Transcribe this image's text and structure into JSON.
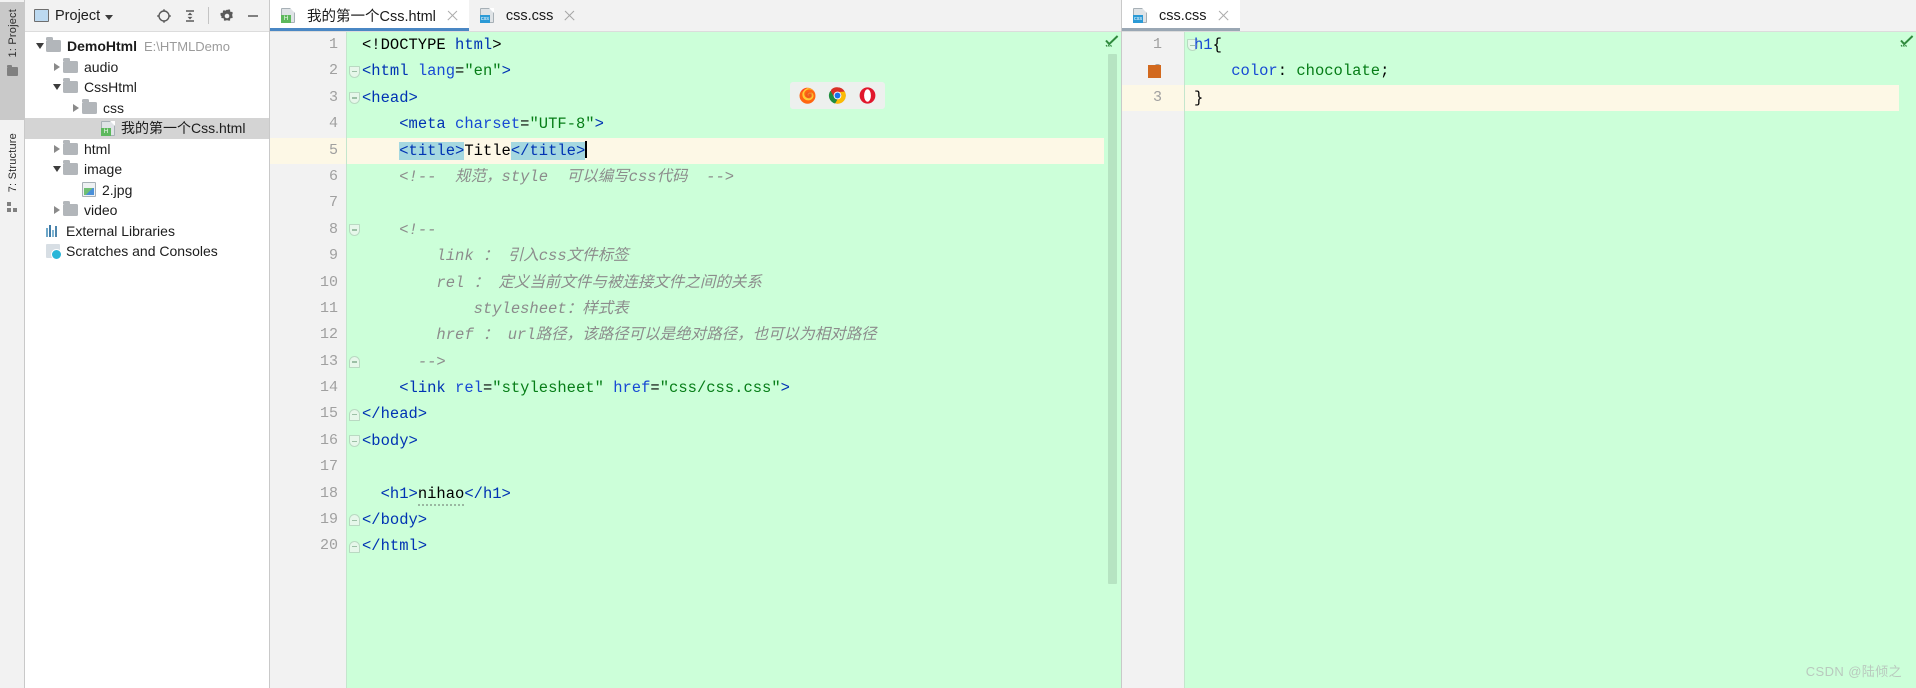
{
  "tool_strip": {
    "tabs": [
      {
        "label": "1: Project",
        "icon": "folder-icon",
        "active": true
      },
      {
        "label": "7: Structure",
        "icon": "structure-icon",
        "active": false
      }
    ]
  },
  "project_panel": {
    "title": "Project",
    "header_icons": [
      "locate-icon",
      "collapse-all-icon",
      "gear-icon",
      "minimize-icon"
    ],
    "tree": [
      {
        "indent": 0,
        "arrow": "down",
        "icon": "folder-icon",
        "label": "DemoHtml",
        "bold": true,
        "path": "E:\\HTMLDemo",
        "selected": false
      },
      {
        "indent": 1,
        "arrow": "right",
        "icon": "folder-icon",
        "label": "audio",
        "bold": false,
        "path": "",
        "selected": false
      },
      {
        "indent": 1,
        "arrow": "down",
        "icon": "folder-icon",
        "label": "CssHtml",
        "bold": false,
        "path": "",
        "selected": false
      },
      {
        "indent": 2,
        "arrow": "right",
        "icon": "folder-icon",
        "label": "css",
        "bold": false,
        "path": "",
        "selected": false
      },
      {
        "indent": 3,
        "arrow": "none",
        "icon": "html-file-icon",
        "label": "我的第一个Css.html",
        "bold": false,
        "path": "",
        "selected": true
      },
      {
        "indent": 1,
        "arrow": "right",
        "icon": "folder-icon",
        "label": "html",
        "bold": false,
        "path": "",
        "selected": false
      },
      {
        "indent": 1,
        "arrow": "down",
        "icon": "folder-icon",
        "label": "image",
        "bold": false,
        "path": "",
        "selected": false
      },
      {
        "indent": 2,
        "arrow": "none",
        "icon": "image-file-icon",
        "label": "2.jpg",
        "bold": false,
        "path": "",
        "selected": false
      },
      {
        "indent": 1,
        "arrow": "right",
        "icon": "folder-icon",
        "label": "video",
        "bold": false,
        "path": "",
        "selected": false
      },
      {
        "indent": 0,
        "arrow": "none",
        "icon": "libraries-icon",
        "label": "External Libraries",
        "bold": false,
        "path": "",
        "selected": false
      },
      {
        "indent": 0,
        "arrow": "none",
        "icon": "scratches-icon",
        "label": "Scratches and Consoles",
        "bold": false,
        "path": "",
        "selected": false
      }
    ]
  },
  "left_pane": {
    "tabs": [
      {
        "label": "我的第一个Css.html",
        "icon": "html-file-icon",
        "active": true
      },
      {
        "label": "css.css",
        "icon": "css-file-icon",
        "active": false
      }
    ],
    "current_line": 5,
    "lines": [
      {
        "n": 1,
        "fold": "none",
        "text": "<!DOCTYPE html>"
      },
      {
        "n": 2,
        "fold": "open",
        "text": "<html lang=\"en\">"
      },
      {
        "n": 3,
        "fold": "open",
        "text": "<head>"
      },
      {
        "n": 4,
        "fold": "none",
        "text": "    <meta charset=\"UTF-8\">"
      },
      {
        "n": 5,
        "fold": "none",
        "text": "    <title>Title</title>"
      },
      {
        "n": 6,
        "fold": "none",
        "text": "    <!-- 规范，style 可以编写css代码 -->"
      },
      {
        "n": 7,
        "fold": "none",
        "text": ""
      },
      {
        "n": 8,
        "fold": "open",
        "text": "    <!--"
      },
      {
        "n": 9,
        "fold": "none",
        "text": "        link ： 引入css文件标签"
      },
      {
        "n": 10,
        "fold": "none",
        "text": "        rel ： 定义当前文件与被连接文件之间的关系"
      },
      {
        "n": 11,
        "fold": "none",
        "text": "            stylesheet：样式表"
      },
      {
        "n": 12,
        "fold": "none",
        "text": "        href ： url路径，该路径可以是绝对路径，也可以为相对路径"
      },
      {
        "n": 13,
        "fold": "close",
        "text": "      -->"
      },
      {
        "n": 14,
        "fold": "none",
        "text": "    <link rel=\"stylesheet\" href=\"css/css.css\">"
      },
      {
        "n": 15,
        "fold": "close",
        "text": "</head>"
      },
      {
        "n": 16,
        "fold": "open",
        "text": "<body>"
      },
      {
        "n": 17,
        "fold": "none",
        "text": ""
      },
      {
        "n": 18,
        "fold": "none",
        "text": "  <h1>nihao</h1>"
      },
      {
        "n": 19,
        "fold": "close",
        "text": "</body>"
      },
      {
        "n": 20,
        "fold": "close",
        "text": "</html>"
      }
    ],
    "status": {
      "inspection": "ok-check-icon"
    },
    "browsers": [
      "firefox-icon",
      "chrome-icon",
      "opera-icon"
    ]
  },
  "right_pane": {
    "tabs": [
      {
        "label": "css.css",
        "icon": "css-file-icon",
        "active": true
      }
    ],
    "current_line": 3,
    "color_chip": "#d2691e",
    "lines": [
      {
        "n": 1,
        "fold": "open",
        "text": "h1{"
      },
      {
        "n": 2,
        "fold": "none",
        "text": "    color: chocolate;"
      },
      {
        "n": 3,
        "fold": "close",
        "text": "}"
      }
    ],
    "status": {
      "inspection": "ok-check-icon"
    }
  },
  "watermark": "CSDN @陆倾之",
  "colors": {
    "editor_background": "#ccffd9",
    "current_line": "#fdf8e6",
    "gutter": "#f2f2f2",
    "tag": "#0033b3",
    "string": "#067d17",
    "comment": "#8c8c8c",
    "selection": "#a5d8e0",
    "tab_underline": "#4a87c4"
  }
}
